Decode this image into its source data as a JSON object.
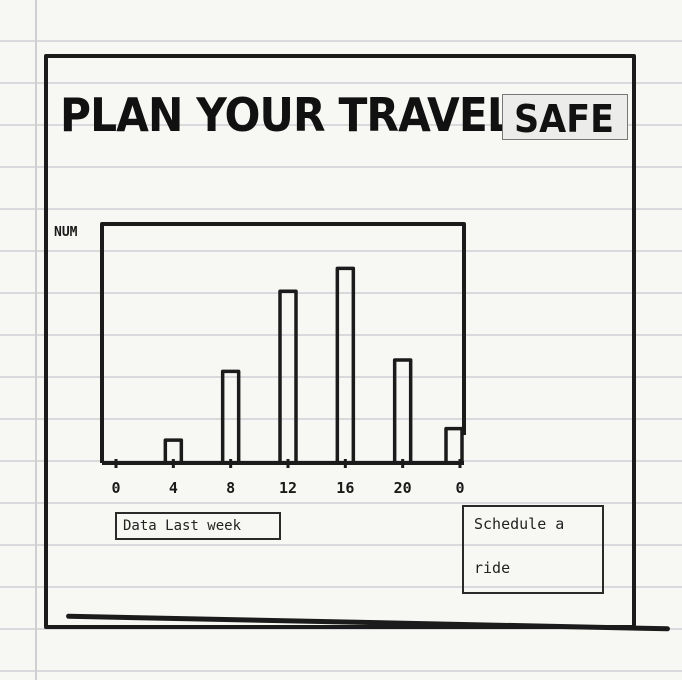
{
  "title": {
    "main": "PLAN YOUR TRAVEL",
    "emphasis": "SAFE"
  },
  "chart_data": {
    "type": "bar",
    "ylabel": "NUM",
    "xlabel": "",
    "x_tick_labels": [
      "0",
      "4",
      "8",
      "12",
      "16",
      "20",
      "0"
    ],
    "categories": [
      "0",
      "4",
      "8",
      "12",
      "16",
      "20",
      "0"
    ],
    "values": [
      0,
      1,
      4,
      7.5,
      8.5,
      4.5,
      1.5
    ],
    "ylim": [
      0,
      10
    ],
    "grid": false,
    "stroke_color": "#1b1b1b"
  },
  "buttons": {
    "data_last_week": "Data Last week",
    "schedule_ride_line1": "Schedule a",
    "schedule_ride_line2": "ride"
  }
}
